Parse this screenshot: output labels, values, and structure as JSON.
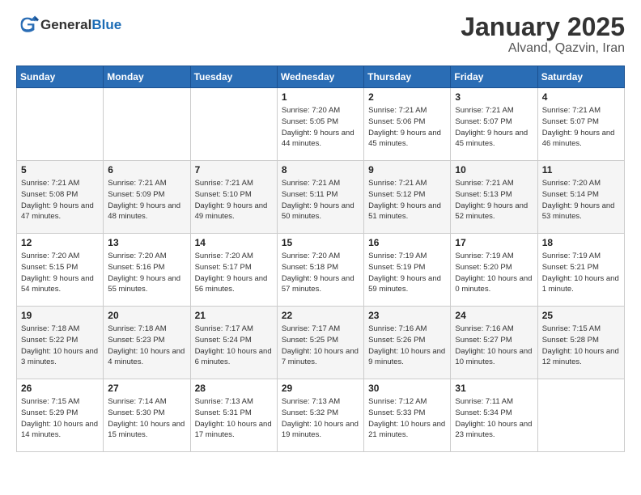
{
  "header": {
    "logo_general": "General",
    "logo_blue": "Blue",
    "title": "January 2025",
    "subtitle": "Alvand, Qazvin, Iran"
  },
  "weekdays": [
    "Sunday",
    "Monday",
    "Tuesday",
    "Wednesday",
    "Thursday",
    "Friday",
    "Saturday"
  ],
  "weeks": [
    [
      {
        "day": null
      },
      {
        "day": null
      },
      {
        "day": null
      },
      {
        "day": 1,
        "sunrise": "Sunrise: 7:20 AM",
        "sunset": "Sunset: 5:05 PM",
        "daylight": "Daylight: 9 hours and 44 minutes."
      },
      {
        "day": 2,
        "sunrise": "Sunrise: 7:21 AM",
        "sunset": "Sunset: 5:06 PM",
        "daylight": "Daylight: 9 hours and 45 minutes."
      },
      {
        "day": 3,
        "sunrise": "Sunrise: 7:21 AM",
        "sunset": "Sunset: 5:07 PM",
        "daylight": "Daylight: 9 hours and 45 minutes."
      },
      {
        "day": 4,
        "sunrise": "Sunrise: 7:21 AM",
        "sunset": "Sunset: 5:07 PM",
        "daylight": "Daylight: 9 hours and 46 minutes."
      }
    ],
    [
      {
        "day": 5,
        "sunrise": "Sunrise: 7:21 AM",
        "sunset": "Sunset: 5:08 PM",
        "daylight": "Daylight: 9 hours and 47 minutes."
      },
      {
        "day": 6,
        "sunrise": "Sunrise: 7:21 AM",
        "sunset": "Sunset: 5:09 PM",
        "daylight": "Daylight: 9 hours and 48 minutes."
      },
      {
        "day": 7,
        "sunrise": "Sunrise: 7:21 AM",
        "sunset": "Sunset: 5:10 PM",
        "daylight": "Daylight: 9 hours and 49 minutes."
      },
      {
        "day": 8,
        "sunrise": "Sunrise: 7:21 AM",
        "sunset": "Sunset: 5:11 PM",
        "daylight": "Daylight: 9 hours and 50 minutes."
      },
      {
        "day": 9,
        "sunrise": "Sunrise: 7:21 AM",
        "sunset": "Sunset: 5:12 PM",
        "daylight": "Daylight: 9 hours and 51 minutes."
      },
      {
        "day": 10,
        "sunrise": "Sunrise: 7:21 AM",
        "sunset": "Sunset: 5:13 PM",
        "daylight": "Daylight: 9 hours and 52 minutes."
      },
      {
        "day": 11,
        "sunrise": "Sunrise: 7:20 AM",
        "sunset": "Sunset: 5:14 PM",
        "daylight": "Daylight: 9 hours and 53 minutes."
      }
    ],
    [
      {
        "day": 12,
        "sunrise": "Sunrise: 7:20 AM",
        "sunset": "Sunset: 5:15 PM",
        "daylight": "Daylight: 9 hours and 54 minutes."
      },
      {
        "day": 13,
        "sunrise": "Sunrise: 7:20 AM",
        "sunset": "Sunset: 5:16 PM",
        "daylight": "Daylight: 9 hours and 55 minutes."
      },
      {
        "day": 14,
        "sunrise": "Sunrise: 7:20 AM",
        "sunset": "Sunset: 5:17 PM",
        "daylight": "Daylight: 9 hours and 56 minutes."
      },
      {
        "day": 15,
        "sunrise": "Sunrise: 7:20 AM",
        "sunset": "Sunset: 5:18 PM",
        "daylight": "Daylight: 9 hours and 57 minutes."
      },
      {
        "day": 16,
        "sunrise": "Sunrise: 7:19 AM",
        "sunset": "Sunset: 5:19 PM",
        "daylight": "Daylight: 9 hours and 59 minutes."
      },
      {
        "day": 17,
        "sunrise": "Sunrise: 7:19 AM",
        "sunset": "Sunset: 5:20 PM",
        "daylight": "Daylight: 10 hours and 0 minutes."
      },
      {
        "day": 18,
        "sunrise": "Sunrise: 7:19 AM",
        "sunset": "Sunset: 5:21 PM",
        "daylight": "Daylight: 10 hours and 1 minute."
      }
    ],
    [
      {
        "day": 19,
        "sunrise": "Sunrise: 7:18 AM",
        "sunset": "Sunset: 5:22 PM",
        "daylight": "Daylight: 10 hours and 3 minutes."
      },
      {
        "day": 20,
        "sunrise": "Sunrise: 7:18 AM",
        "sunset": "Sunset: 5:23 PM",
        "daylight": "Daylight: 10 hours and 4 minutes."
      },
      {
        "day": 21,
        "sunrise": "Sunrise: 7:17 AM",
        "sunset": "Sunset: 5:24 PM",
        "daylight": "Daylight: 10 hours and 6 minutes."
      },
      {
        "day": 22,
        "sunrise": "Sunrise: 7:17 AM",
        "sunset": "Sunset: 5:25 PM",
        "daylight": "Daylight: 10 hours and 7 minutes."
      },
      {
        "day": 23,
        "sunrise": "Sunrise: 7:16 AM",
        "sunset": "Sunset: 5:26 PM",
        "daylight": "Daylight: 10 hours and 9 minutes."
      },
      {
        "day": 24,
        "sunrise": "Sunrise: 7:16 AM",
        "sunset": "Sunset: 5:27 PM",
        "daylight": "Daylight: 10 hours and 10 minutes."
      },
      {
        "day": 25,
        "sunrise": "Sunrise: 7:15 AM",
        "sunset": "Sunset: 5:28 PM",
        "daylight": "Daylight: 10 hours and 12 minutes."
      }
    ],
    [
      {
        "day": 26,
        "sunrise": "Sunrise: 7:15 AM",
        "sunset": "Sunset: 5:29 PM",
        "daylight": "Daylight: 10 hours and 14 minutes."
      },
      {
        "day": 27,
        "sunrise": "Sunrise: 7:14 AM",
        "sunset": "Sunset: 5:30 PM",
        "daylight": "Daylight: 10 hours and 15 minutes."
      },
      {
        "day": 28,
        "sunrise": "Sunrise: 7:13 AM",
        "sunset": "Sunset: 5:31 PM",
        "daylight": "Daylight: 10 hours and 17 minutes."
      },
      {
        "day": 29,
        "sunrise": "Sunrise: 7:13 AM",
        "sunset": "Sunset: 5:32 PM",
        "daylight": "Daylight: 10 hours and 19 minutes."
      },
      {
        "day": 30,
        "sunrise": "Sunrise: 7:12 AM",
        "sunset": "Sunset: 5:33 PM",
        "daylight": "Daylight: 10 hours and 21 minutes."
      },
      {
        "day": 31,
        "sunrise": "Sunrise: 7:11 AM",
        "sunset": "Sunset: 5:34 PM",
        "daylight": "Daylight: 10 hours and 23 minutes."
      },
      {
        "day": null
      }
    ]
  ]
}
